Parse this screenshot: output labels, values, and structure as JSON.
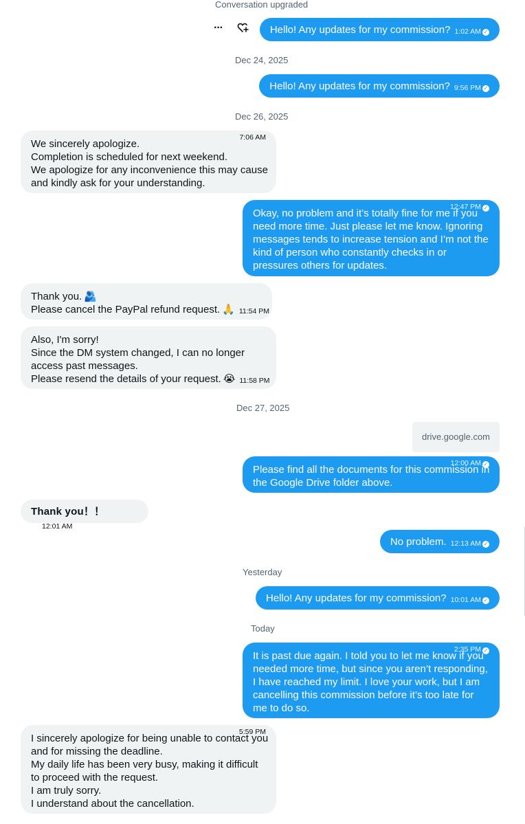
{
  "system_notice": "Conversation upgraded",
  "actions": {
    "more_icon": "more-dots-icon",
    "react_icon": "heart-plus-icon",
    "more_glyph": "···",
    "react_glyph": "♡"
  },
  "dates": {
    "d1": "Dec 24, 2025",
    "d2": "Dec 26, 2025",
    "d3": "Dec 27, 2025",
    "d4": "Yesterday",
    "d5": "Today"
  },
  "messages": {
    "m1": {
      "text": "Hello! Any updates for my commission?",
      "time": "1:02 AM"
    },
    "m2": {
      "text": "Hello! Any updates for my commission?",
      "time": "9:56 PM"
    },
    "m3": {
      "lines": [
        "We sincerely apologize.",
        "Completion is scheduled for next weekend.",
        "We apologize for any inconvenience this may cause",
        "and kindly ask for your understanding."
      ],
      "time": "7:06 AM"
    },
    "m4": {
      "lines": [
        "Okay, no problem and it’s totally fine for me if you",
        "need more time. Just please let me know. Ignoring",
        "messages tends to increase tension and I’m not the",
        "kind of person who constantly checks in or",
        "pressures others for updates."
      ],
      "time": "12:47 PM"
    },
    "m5": {
      "lines": [
        "Thank you.",
        "Please cancel the PayPal refund request."
      ],
      "emoji1": "🫂",
      "emoji2": "🙏",
      "time": "11:54 PM"
    },
    "m6": {
      "lines": [
        "Also, I'm sorry!",
        "Since the DM system changed, I can no longer",
        "access past messages.",
        "Please resend the details of your request."
      ],
      "emoji": "😭",
      "time": "11:58 PM"
    },
    "link_card": {
      "domain": "drive.google.com"
    },
    "m7": {
      "lines": [
        "Please find all the documents for this commission in",
        "the Google Drive folder above."
      ],
      "time": "12:00 AM"
    },
    "m8": {
      "text": "Thank you！！",
      "time": "12:01 AM"
    },
    "m9": {
      "text": "No problem.",
      "time": "12:13 AM"
    },
    "m10": {
      "text": "Hello! Any updates for my commission?",
      "time": "10:01 AM"
    },
    "m11": {
      "lines": [
        "It is past due again. I told you to let me know if you",
        "needed more time, but since you aren’t responding,",
        "I have reached my limit. I love your work, but I am",
        "cancelling this commission before it’s too late for",
        "me to do so."
      ],
      "time": "2:35 PM"
    },
    "m12": {
      "lines": [
        "I sincerely apologize for being unable to contact you",
        "and for missing the deadline.",
        "My daily life has been very busy, making it difficult",
        "to proceed with the request.",
        "I am truly sorry.",
        "I understand about the cancellation."
      ],
      "time": "5:59 PM"
    }
  },
  "colors": {
    "outgoing_bubble": "#1d9bf0",
    "incoming_bubble": "#eff3f4",
    "secondary_text": "#536471"
  }
}
